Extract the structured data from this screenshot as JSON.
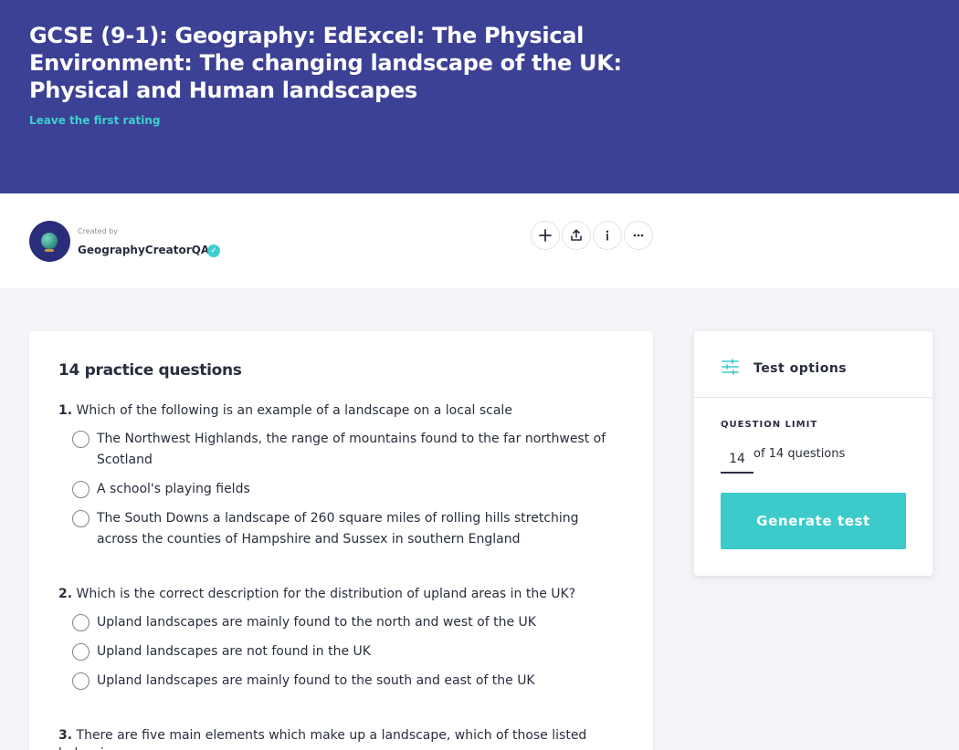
{
  "hero": {
    "title": "GCSE (9-1): Geography: EdExcel: The Physical Environment: The changing landscape of the UK: Physical and Human landscapes",
    "rating_link": "Leave the first rating"
  },
  "creator": {
    "created_by_label": "Created by",
    "name": "GeographyCreatorQA2",
    "verified_icon": "verified-check-icon"
  },
  "actions": [
    {
      "icon": "plus-icon"
    },
    {
      "icon": "share-icon"
    },
    {
      "icon": "info-icon"
    },
    {
      "icon": "more-icon"
    }
  ],
  "practice": {
    "heading": "14 practice questions",
    "questions": [
      {
        "number": "1.",
        "text": "Which of the following is an example of a landscape on a local scale",
        "options": [
          "The Northwest Highlands, the range of mountains found to the far northwest of Scotland",
          "A school's playing fields",
          "The South Downs a landscape of 260 square miles of rolling hills stretching across the counties of Hampshire and Sussex in southern England"
        ]
      },
      {
        "number": "2.",
        "text": "Which is the correct description for the distribution of upland areas in the UK?",
        "options": [
          "Upland landscapes are mainly found to the north and west of the UK",
          "Upland landscapes are not found in the UK",
          "Upland landscapes are mainly found to the south and east of the UK"
        ]
      },
      {
        "number": "3.",
        "text": "There are five main elements which make up a landscape, which of those listed below is",
        "options": []
      }
    ]
  },
  "test_options": {
    "title": "Test options",
    "icon": "sliders-icon",
    "question_limit_label": "QUESTION LIMIT",
    "question_limit_value": "14",
    "question_limit_suffix": "of 14 questions",
    "generate_label": "Generate test"
  },
  "colors": {
    "hero_bg": "#3c4195",
    "accent": "#3ccaca",
    "page_bg": "#f4f5f9"
  }
}
